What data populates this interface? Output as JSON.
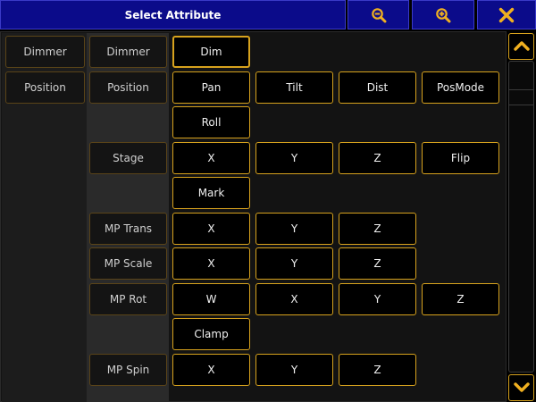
{
  "window": {
    "title": "Select Attribute",
    "zoom_out_icon": "zoom-out-icon",
    "zoom_in_icon": "zoom-in-icon",
    "close_icon": "close-icon"
  },
  "colors": {
    "title_bar": "#0b0b8a",
    "accent": "#d7a21d",
    "icon": "#f0b020"
  },
  "feature_groups": [
    "Dimmer",
    "Position"
  ],
  "rows": [
    {
      "feature": "Dimmer",
      "attributes": [
        "Dim"
      ]
    },
    {
      "feature": "Position",
      "attributes": [
        "Pan",
        "Tilt",
        "Dist",
        "PosMode"
      ]
    },
    {
      "feature": "",
      "attributes": [
        "Roll"
      ]
    },
    {
      "feature": "Stage",
      "attributes": [
        "X",
        "Y",
        "Z",
        "Flip"
      ]
    },
    {
      "feature": "",
      "attributes": [
        "Mark"
      ]
    },
    {
      "feature": "MP Trans",
      "attributes": [
        "X",
        "Y",
        "Z"
      ]
    },
    {
      "feature": "MP Scale",
      "attributes": [
        "X",
        "Y",
        "Z"
      ]
    },
    {
      "feature": "MP Rot",
      "attributes": [
        "W",
        "X",
        "Y",
        "Z"
      ]
    },
    {
      "feature": "",
      "attributes": [
        "Clamp"
      ]
    },
    {
      "feature": "MP Spin",
      "attributes": [
        "X",
        "Y",
        "Z"
      ]
    }
  ],
  "selected": {
    "row": 0,
    "col": 0
  },
  "scrollbar": {
    "up_icon": "chevron-up-icon",
    "down_icon": "chevron-down-icon"
  }
}
